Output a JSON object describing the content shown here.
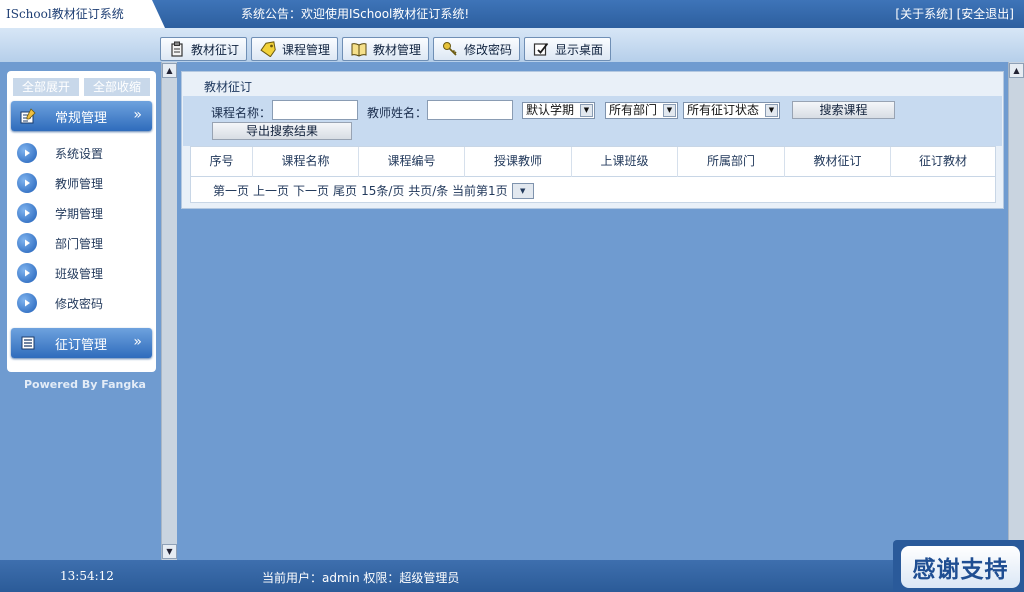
{
  "app": {
    "title": "ISchool教材征订系统",
    "announcement": "系统公告：欢迎使用ISchool教材征订系统!",
    "links": {
      "about": "[关于系统]",
      "logout": "[安全退出]"
    }
  },
  "toolbar": {
    "buttons": [
      {
        "label": "教材征订",
        "icon": "clipboard-icon"
      },
      {
        "label": "课程管理",
        "icon": "tag-icon"
      },
      {
        "label": "教材管理",
        "icon": "book-icon"
      },
      {
        "label": "修改密码",
        "icon": "key-icon"
      },
      {
        "label": "显示桌面",
        "icon": "desktop-icon"
      }
    ]
  },
  "sidebar": {
    "expand_all": "全部展开",
    "collapse_all": "全部收缩",
    "groups": [
      {
        "label": "常规管理",
        "icon": "gear-icon",
        "items": [
          "系统设置",
          "教师管理",
          "学期管理",
          "部门管理",
          "班级管理",
          "修改密码"
        ]
      },
      {
        "label": "征订管理",
        "icon": "list-icon",
        "items": []
      }
    ],
    "powered_by": "Powered By Fangka"
  },
  "main": {
    "panel_title": "教材征订",
    "search": {
      "course_name_label": "课程名称：",
      "course_name_value": "",
      "teacher_name_label": "教师姓名：",
      "teacher_name_value": "",
      "term_select": "默认学期",
      "dept_select": "所有部门",
      "status_select": "所有征订状态",
      "search_button": "搜索课程",
      "export_button": "导出搜索结果"
    },
    "table": {
      "columns": [
        "序号",
        "课程名称",
        "课程编号",
        "授课教师",
        "上课班级",
        "所属部门",
        "教材征订",
        "征订教材"
      ],
      "rows": []
    },
    "pager": {
      "first": "第一页",
      "prev": "上一页",
      "next": "下一页",
      "last": "尾页",
      "summary": "15条/页 共页/条 当前第1页"
    }
  },
  "status": {
    "time": "13:54:12",
    "user_info": "当前用户：admin   权限：超级管理员",
    "thanks": "感谢支持"
  },
  "colors": {
    "background": "#6f9bd0",
    "bar": "#2d5f9f",
    "panel": "#e9f0f8",
    "search_area": "#c7daf0"
  }
}
